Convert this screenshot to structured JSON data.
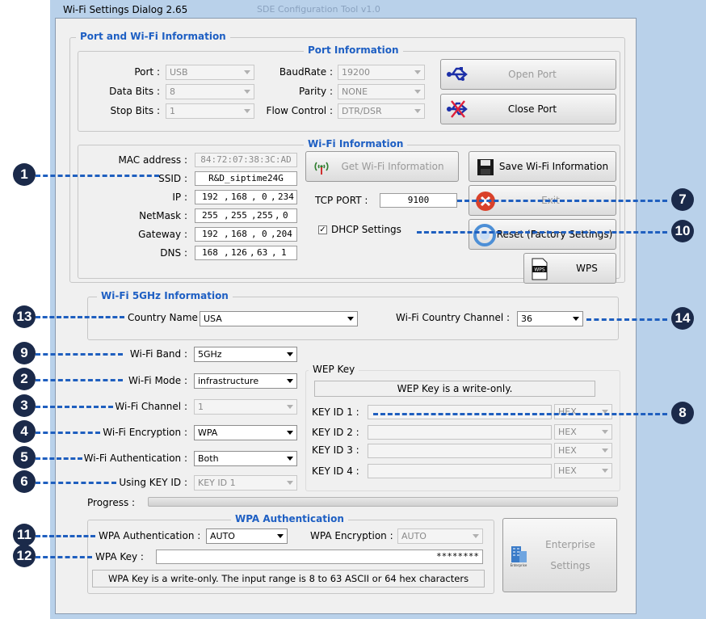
{
  "window": {
    "title": "Wi-Fi Settings Dialog 2.65",
    "background_title": "SDE Configuration Tool v1.0"
  },
  "port_wifi_group": {
    "title": "Port and Wi-Fi Information"
  },
  "port_info": {
    "title": "Port Information",
    "port_label": "Port :",
    "port_value": "USB",
    "baudrate_label": "BaudRate :",
    "baudrate_value": "19200",
    "databits_label": "Data Bits :",
    "databits_value": "8",
    "parity_label": "Parity :",
    "parity_value": "NONE",
    "stopbits_label": "Stop Bits :",
    "stopbits_value": "1",
    "flowcontrol_label": "Flow Control :",
    "flowcontrol_value": "DTR/DSR",
    "open_port": "Open Port",
    "close_port": "Close Port"
  },
  "wifi_info": {
    "title": "Wi-Fi Information",
    "mac_label": "MAC address :",
    "mac_value": "84:72:07:38:3C:AD",
    "ssid_label": "SSID :",
    "ssid_value": "R&D_siptime24G",
    "ip_label": "IP :",
    "ip": [
      "192",
      "168",
      "0",
      "234"
    ],
    "netmask_label": "NetMask :",
    "netmask": [
      "255",
      "255",
      "255",
      "0"
    ],
    "gateway_label": "Gateway :",
    "gateway": [
      "192",
      "168",
      "0",
      "204"
    ],
    "dns_label": "DNS :",
    "dns": [
      "168",
      "126",
      "63",
      "1"
    ],
    "get_wifi": "Get Wi-Fi Information",
    "save_wifi": "Save Wi-Fi Information",
    "tcp_port_label": "TCP PORT :",
    "tcp_port_value": "9100",
    "exit": "Exit",
    "dhcp_label": "DHCP Settings",
    "dhcp_checked": "✓",
    "reset": "Reset (Factory Settings)",
    "wps": "WPS"
  },
  "wifi5g": {
    "title": "Wi-Fi 5GHz Information",
    "country_name_label": "Country Name",
    "country_name_value": "USA",
    "country_channel_label": "Wi-Fi Country Channel :",
    "country_channel_value": "36"
  },
  "wifi_settings": {
    "band_label": "Wi-Fi Band :",
    "band_value": "5GHz",
    "mode_label": "Wi-Fi Mode :",
    "mode_value": "infrastructure",
    "channel_label": "Wi-Fi Channel :",
    "channel_value": "1",
    "encryption_label": "Wi-Fi Encryption :",
    "encryption_value": "WPA",
    "auth_label": "Wi-Fi Authentication :",
    "auth_value": "Both",
    "keyid_label": "Using KEY ID :",
    "keyid_value": "KEY ID 1"
  },
  "wep": {
    "title": "WEP Key",
    "note": "WEP Key is a write-only.",
    "keys": [
      {
        "label": "KEY ID 1 :",
        "format": "HEX"
      },
      {
        "label": "KEY ID 2 :",
        "format": "HEX"
      },
      {
        "label": "KEY ID 3 :",
        "format": "HEX"
      },
      {
        "label": "KEY ID 4 :",
        "format": "HEX"
      }
    ]
  },
  "progress": {
    "label": "Progress :",
    "fraction": 0
  },
  "wpa": {
    "title": "WPA Authentication",
    "auth_label": "WPA Authentication :",
    "auth_value": "AUTO",
    "enc_label": "WPA Encryption :",
    "enc_value": "AUTO",
    "key_label": "WPA Key :",
    "key_value": "********",
    "note": "WPA Key is a write-only. The input range is 8 to 63 ASCII or 64 hex characters",
    "enterprise_line1": "Enterprise",
    "enterprise_line2": "Settings",
    "enterprise_icon_text": "Enterprise"
  },
  "callouts": [
    "1",
    "7",
    "10",
    "13",
    "14",
    "9",
    "2",
    "3",
    "8",
    "4",
    "5",
    "6",
    "11",
    "12"
  ],
  "colors": {
    "callout": "#1b2a4a",
    "leader": "#1f5fbf",
    "group_title": "#1e5fc3"
  }
}
